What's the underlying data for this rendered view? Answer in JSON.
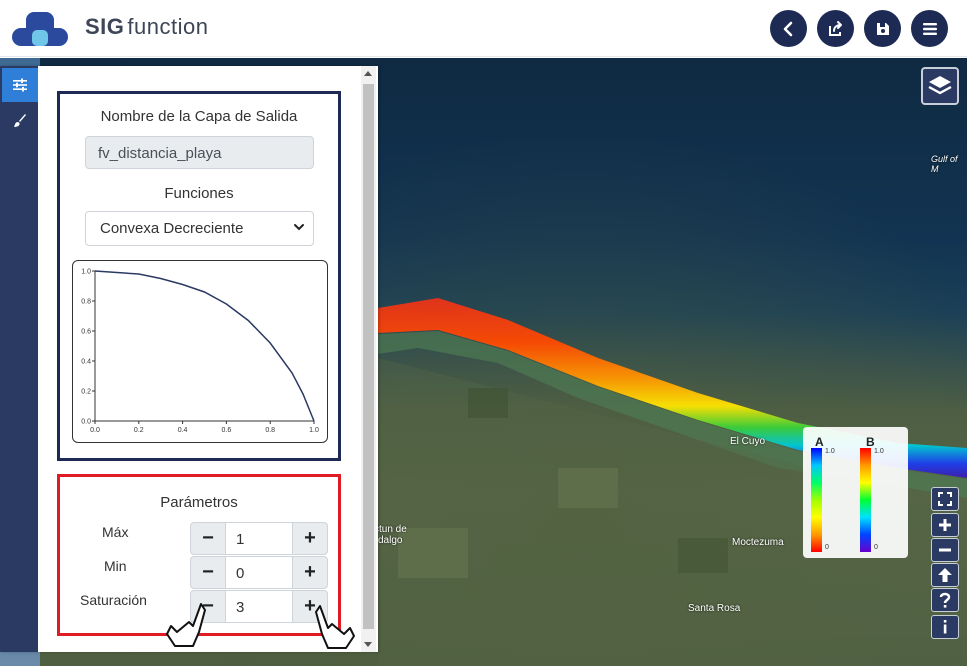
{
  "app": {
    "brand_bold": "SIG",
    "brand_rest": "function"
  },
  "header": {
    "buttons": [
      {
        "name": "back",
        "icon": "chevron-left-icon"
      },
      {
        "name": "share",
        "icon": "share-export-icon"
      },
      {
        "name": "save",
        "icon": "floppy-disk-icon"
      },
      {
        "name": "menu",
        "icon": "hamburger-menu-icon"
      }
    ]
  },
  "sidebar": {
    "items": [
      {
        "name": "settings",
        "icon": "sliders-icon",
        "active": true
      },
      {
        "name": "style",
        "icon": "paintbrush-icon",
        "active": false
      }
    ]
  },
  "output": {
    "label": "Nombre de la Capa de Salida",
    "value": "fv_distancia_playa"
  },
  "functions": {
    "label": "Funciones",
    "selected": "Convexa Decreciente"
  },
  "chart_data": {
    "type": "line",
    "xlim": [
      0,
      1
    ],
    "ylim": [
      0,
      1
    ],
    "x_ticks": [
      "0.0",
      "0.2",
      "0.4",
      "0.6",
      "0.8",
      "1.0"
    ],
    "y_ticks": [
      "0.0",
      "0.2",
      "0.4",
      "0.6",
      "0.8",
      "1.0"
    ],
    "series": [
      {
        "x": [
          0,
          0.1,
          0.2,
          0.3,
          0.4,
          0.5,
          0.6,
          0.7,
          0.8,
          0.9,
          0.95,
          1.0
        ],
        "y": [
          1.0,
          0.99,
          0.98,
          0.95,
          0.91,
          0.86,
          0.78,
          0.67,
          0.52,
          0.32,
          0.18,
          0.0
        ]
      }
    ],
    "grid": false,
    "colors": [
      "#2b3a62"
    ]
  },
  "params": {
    "title": "Parámetros",
    "rows": [
      {
        "label": "Máx",
        "value": "1"
      },
      {
        "label": "Min",
        "value": "0"
      },
      {
        "label": "Saturación",
        "value": "3"
      }
    ],
    "minus": "−",
    "plus": "+"
  },
  "legend": {
    "a": {
      "title": "A",
      "top": "1.0",
      "bottom": "0"
    },
    "b": {
      "title": "B",
      "top": "1.0",
      "bottom": "0"
    }
  },
  "map_labels": [
    "Gulf of M",
    "El Cuyo",
    "Moctezuma",
    "Santa Rosa",
    "ctun de",
    "dalgo"
  ],
  "map_controls": [
    "fullscreen-icon",
    "zoom-in-icon",
    "zoom-out-icon",
    "north-arrow-icon",
    "help-icon",
    "info-icon"
  ],
  "colors": {
    "navy": "#1c2a54",
    "accent": "#2f7fd9",
    "highlight": "#e01b24"
  }
}
